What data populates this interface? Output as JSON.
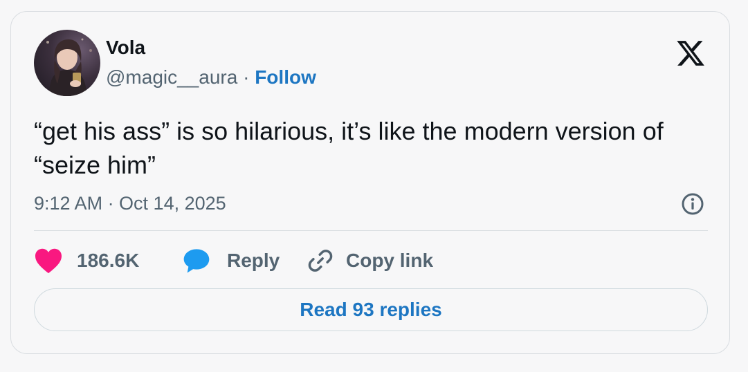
{
  "author": {
    "name": "Vola",
    "handle": "@magic__aura",
    "separator": " · ",
    "follow_label": "Follow"
  },
  "tweet": {
    "text": "“get his ass” is so hilarious, it’s like the modern version of “seize him”",
    "timestamp": "9:12 AM · Oct 14, 2025"
  },
  "actions": {
    "likes": "186.6K",
    "reply_label": "Reply",
    "copy_link_label": "Copy link"
  },
  "read_replies_label": "Read 93 replies",
  "icons": {
    "logo": "x-logo-icon",
    "info": "info-icon",
    "like": "heart-icon",
    "reply": "speech-bubble-icon",
    "copy": "link-icon"
  },
  "colors": {
    "heart": "#f91880",
    "reply_bubble": "#1d9bf0",
    "accent": "#1d76c2",
    "text": "#0f1419",
    "muted": "#536471"
  }
}
